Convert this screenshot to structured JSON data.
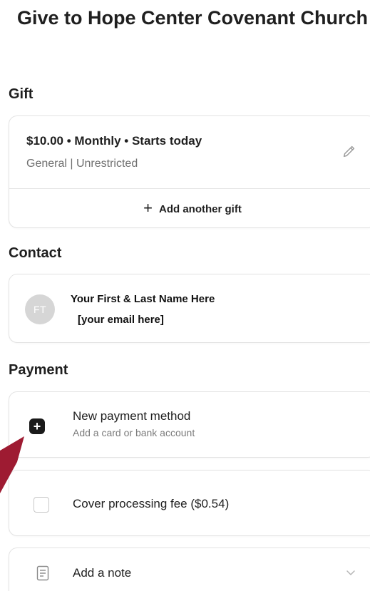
{
  "page": {
    "title": "Give to Hope Center Covenant Church"
  },
  "gift": {
    "heading": "Gift",
    "summary": "$10.00 • Monthly • Starts today",
    "fund": "General | Unrestricted",
    "add_another_label": "Add another gift"
  },
  "contact": {
    "heading": "Contact",
    "avatar_initials": "FT",
    "name": "Your First & Last Name Here",
    "email": "[your email here]"
  },
  "payment": {
    "heading": "Payment",
    "method_title": "New payment method",
    "method_subtitle": "Add a card or bank account"
  },
  "fee": {
    "label": "Cover processing fee ($0.54)",
    "checked": false
  },
  "note": {
    "label": "Add a note"
  },
  "icons": {
    "edit": "pencil-icon",
    "add": "plus-icon",
    "note": "document-icon",
    "expand": "chevron-down-icon"
  },
  "colors": {
    "accent_red": "#9e1b32",
    "text_primary": "#1f1f1f",
    "text_secondary": "#6f6f6f",
    "avatar_bg": "#d6d6d6"
  }
}
